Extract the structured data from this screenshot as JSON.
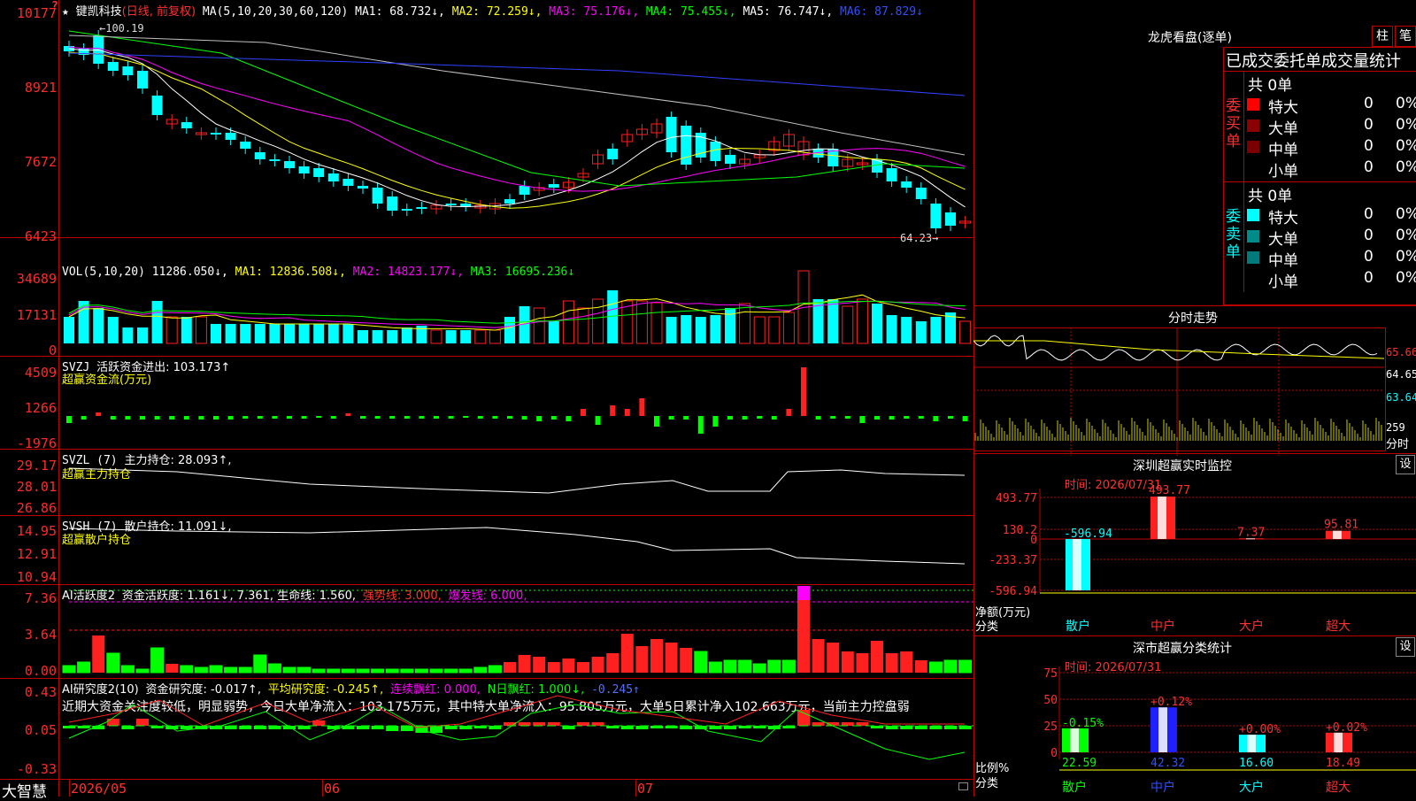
{
  "main_header": {
    "star": "★",
    "stock_name": "键凯科技",
    "period": "(日线, 前复权)",
    "ma_params": "MA(5,10,20,30,60,120)",
    "ma1": "MA1: 68.732↓,",
    "ma2": "MA2: 72.259↓,",
    "ma3": "MA3: 75.176↓,",
    "ma4": "MA4: 75.455↓,",
    "ma5": "MA5: 76.747↓,",
    "ma6": "MA6: 87.829↓"
  },
  "price_axis": [
    "10177",
    "8921",
    "7672",
    "6423"
  ],
  "price_marks": {
    "high": "100.19",
    "low": "64.23"
  },
  "vol_header": {
    "name": "VOL(5,10,20)",
    "val": "11286.050↓,",
    "ma1": "MA1: 12836.508↓,",
    "ma2": "MA2: 14823.177↓,",
    "ma3": "MA3: 16695.236↓"
  },
  "vol_axis": [
    "34689",
    "17131",
    "0"
  ],
  "svzj_header": {
    "name": "SVZJ",
    "label": "活跃资金进出: 103.173↑",
    "sub": "超赢资金流(万元)"
  },
  "svzj_axis": [
    "4509",
    "1266",
    "-1976"
  ],
  "svzl_header": {
    "name": "SVZL (7)",
    "label": "主力持仓: 28.093↑,",
    "sub": "超赢主力持仓"
  },
  "svzl_axis": [
    "29.17",
    "28.01",
    "26.86"
  ],
  "svsh_header": {
    "name": "SVSH (7)",
    "label": "散户持仓: 11.091↓,",
    "sub": "超赢散户持仓"
  },
  "svsh_axis": [
    "14.95",
    "12.91",
    "10.94"
  ],
  "ai2_header": {
    "name": "AI活跃度2",
    "label": "资金活跃度: 1.161↓, 7.361, 生命线: 1.560,",
    "strong": "强势线: 3.000,",
    "burst": "爆发线: 6.000,"
  },
  "ai2_axis": [
    "7.36",
    "3.64",
    "0.00"
  ],
  "ai3_header": {
    "name": "AI研究度2(10)",
    "label": "资金研究度: -0.017↑,",
    "avg": "平均研究度: -0.245↑,",
    "red1": "连续飘红: 0.000,",
    "red2": "N日飘红: 1.000↓,",
    "last": "-0.245↑"
  },
  "ai3_text": "近期大资金关注度较低，明显弱势，今日大单净流入：103.175万元，其中特大单净流入：95.805万元，大单5日累计净入102.663万元，当前主力控盘弱",
  "ai3_axis": [
    "0.43",
    "0.05",
    "-0.33"
  ],
  "bottom": {
    "logo": "大智慧",
    "d1": "2026/05",
    "d2": "06",
    "d3": "07"
  },
  "longhu": {
    "title": "龙虎看盘(逐单)",
    "btn1": "柱",
    "btn2": "笔",
    "subtitle": "已成交委托单成交量统计",
    "buy_side": "委买单",
    "sell_side": "委卖单",
    "buy_total": "共 0单",
    "sell_total": "共 0单",
    "buy": [
      {
        "name": "特大",
        "v": "0",
        "p": "0%",
        "color": "#ff0000"
      },
      {
        "name": "大单",
        "v": "0",
        "p": "0%",
        "color": "#8b0000"
      },
      {
        "name": "中单",
        "v": "0",
        "p": "0%",
        "color": "#7a0000"
      },
      {
        "name": "小单",
        "v": "0",
        "p": "0%",
        "color": "#000000"
      }
    ],
    "sell": [
      {
        "name": "特大",
        "v": "0",
        "p": "0%",
        "color": "#00ffff"
      },
      {
        "name": "大单",
        "v": "0",
        "p": "0%",
        "color": "#008b8b"
      },
      {
        "name": "中单",
        "v": "0",
        "p": "0%",
        "color": "#007a7a"
      },
      {
        "name": "小单",
        "v": "0",
        "p": "0%",
        "color": "#000000"
      }
    ]
  },
  "intraday": {
    "title": "分时走势",
    "axis": [
      "65.66",
      "64.65",
      "63.64"
    ],
    "vol": "259",
    "vol_lbl": "分时"
  },
  "sz_monitor": {
    "title": "深圳超赢实时监控",
    "set": "设",
    "time": "时间: 2026/07/31",
    "axis": [
      "493.77",
      "130.2",
      "0",
      "-233.37",
      "-596.94"
    ],
    "bars": [
      {
        "cat": "散户",
        "v": "-596.94",
        "val": -596.94
      },
      {
        "cat": "中户",
        "v": "493.77",
        "val": 493.77
      },
      {
        "cat": "大户",
        "v": "7.37",
        "val": 7.37
      },
      {
        "cat": "超大",
        "v": "95.81",
        "val": 95.81
      }
    ],
    "ylbl1": "净额(万元)",
    "ylbl2": "分类"
  },
  "sz_class": {
    "title": "深市超赢分类统计",
    "set": "设",
    "time": "时间: 2026/07/31",
    "axis": [
      "75",
      "50",
      "25",
      "0"
    ],
    "bars": [
      {
        "cat": "散户",
        "v": "22.59",
        "chg": "-0.15%",
        "val": 22.59
      },
      {
        "cat": "中户",
        "v": "42.32",
        "chg": "+0.12%",
        "val": 42.32
      },
      {
        "cat": "大户",
        "v": "16.60",
        "chg": "+0.00%",
        "val": 16.6
      },
      {
        "cat": "超大",
        "v": "18.49",
        "chg": "+0.02%",
        "val": 18.49
      }
    ],
    "ylbl1": "比例%",
    "ylbl2": "分类"
  },
  "colors": {
    "up": "#ff2020",
    "down": "#00ffff",
    "grid": "#b00000"
  }
}
